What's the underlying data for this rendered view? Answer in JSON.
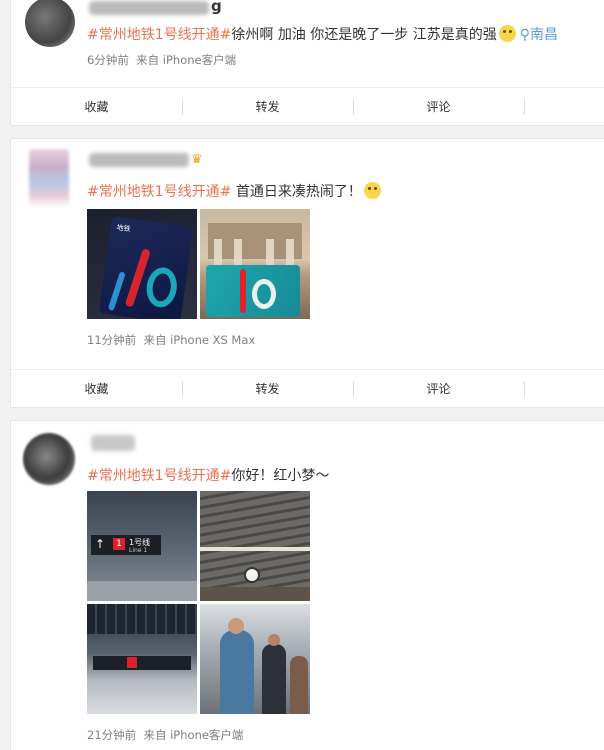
{
  "posts": [
    {
      "username_fragment": "g",
      "topic": "#常州地铁1号线开通#",
      "text": "徐州啊 加油 你还是晚了一步 江苏是真的强",
      "location": "南昌",
      "time": "6分钟前",
      "source": "来自 iPhone客户端"
    },
    {
      "topic": "#常州地铁1号线开通#",
      "text": " 首通日来凑热闹了！",
      "time": "11分钟前",
      "source": "来自 iPhone XS Max"
    },
    {
      "topic": "#常州地铁1号线开通#",
      "text": "你好！红小梦～",
      "time": "21分钟前",
      "source": "来自 iPhone客户端"
    }
  ],
  "actions": {
    "collect": "收藏",
    "repost": "转发",
    "comment": "评论"
  },
  "images": {
    "card_sign": "地铁",
    "station_sign_label": "1号线",
    "station_sign_sub": "Line 1"
  },
  "colors": {
    "topic": "#eb7350",
    "location": "#5d9bd7",
    "meta": "#808080"
  }
}
